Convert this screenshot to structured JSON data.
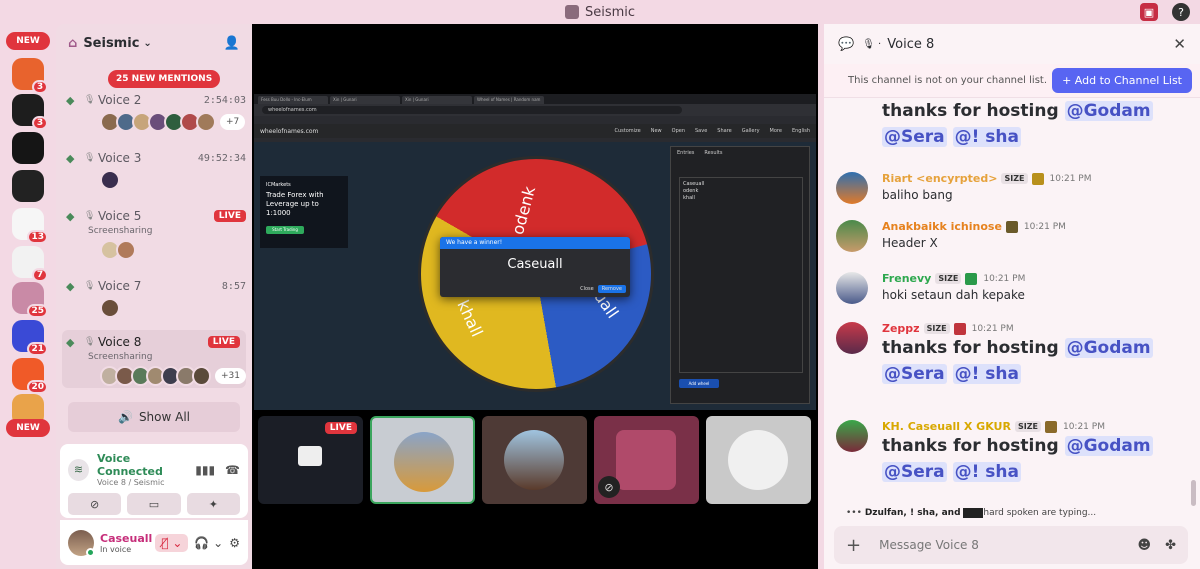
{
  "window": {
    "title": "Seismic"
  },
  "rail": {
    "new_top": "NEW",
    "new_bottom": "NEW",
    "servers": [
      {
        "icon": "orange-app-icon",
        "badge": "3",
        "color": "#e8632d"
      },
      {
        "icon": "dark-logo-icon",
        "badge": "3",
        "color": "#1d1d1d"
      },
      {
        "icon": "ring-logo-icon",
        "badge": "",
        "color": "#151515"
      },
      {
        "icon": "clock-logo-icon",
        "badge": "",
        "color": "#222"
      },
      {
        "icon": "p2-logo-icon",
        "badge": "13",
        "color": "#f6f6f6"
      },
      {
        "icon": "a-logo-icon",
        "badge": "7",
        "color": "#f2f2f2"
      },
      {
        "icon": "seismic-server-icon",
        "badge": "25",
        "color": "#c98aa6"
      },
      {
        "icon": "blue-logo-icon",
        "badge": "21",
        "color": "#3a4ad6"
      },
      {
        "icon": "bolt-logo-icon",
        "badge": "20",
        "color": "#f05a28"
      },
      {
        "icon": "monkey-logo-icon",
        "badge": "",
        "color": "#e9a34a"
      }
    ]
  },
  "sidebar": {
    "server_name": "Seismic",
    "mentions": "25 NEW MENTIONS",
    "channels": [
      {
        "name": "Voice 2",
        "timer": "2:54:03",
        "sub": "",
        "more": "+7",
        "live": ""
      },
      {
        "name": "Voice 3",
        "timer": "49:52:34",
        "sub": "",
        "more": "",
        "live": ""
      },
      {
        "name": "Voice 5",
        "timer": "",
        "sub": "Screensharing",
        "more": "",
        "live": "LIVE"
      },
      {
        "name": "Voice 7",
        "timer": "8:57",
        "sub": "",
        "more": "",
        "live": ""
      },
      {
        "name": "Voice 8",
        "timer": "",
        "sub": "Screensharing",
        "more": "+31",
        "live": "LIVE"
      }
    ],
    "show_all": "Show All"
  },
  "voice_panel": {
    "title": "Voice Connected",
    "subtitle": "Voice 8 / Seismic"
  },
  "user": {
    "name": "Caseuall",
    "status": "In voice"
  },
  "stream": {
    "site": "wheelofnames.com",
    "tabs": [
      "Fess Buu Dollo - Inc-Elum",
      "Xin | Gunari",
      "Xin | Gunari",
      "Wheel of Names | Random nam"
    ],
    "url": "wheelofnames.com",
    "menu": [
      "Customize",
      "New",
      "Open",
      "Save",
      "Share",
      "Gallery",
      "More",
      "English"
    ],
    "ad": {
      "brand": "ICMarkets",
      "headline": "Trade Forex with Leverage up to 1:1000",
      "cta": "Start Trading"
    },
    "panel_tabs": [
      "Entries",
      "Results"
    ],
    "entries": [
      "Caseuall",
      "odenk",
      "khall"
    ],
    "add_wheel": "Add wheel",
    "wheel_labels": [
      "odenk",
      "Caseuall",
      "khall"
    ],
    "winner": {
      "title": "We have a winner!",
      "name": "Caseuall",
      "close": "Close",
      "remove": "Remove"
    },
    "live_badge": "LIVE"
  },
  "chat": {
    "channel": "Voice 8",
    "notice": "This channel is not on your channel list.",
    "add_button": "Add to Channel List",
    "messages": [
      {
        "user": "",
        "tag": "",
        "time": "",
        "text": "",
        "big": [
          "thanks for hosting ",
          "@Godam",
          " ",
          "@Sera",
          " ",
          "@! sha"
        ],
        "color": "#2b2d31"
      },
      {
        "user": "Riart <encyrpted>",
        "tag": "SIZE",
        "time": "10:21 PM",
        "text": "baliho bang",
        "color": "#e6a23c"
      },
      {
        "user": "Anakbaikk ichinose",
        "tag": "",
        "time": "10:21 PM",
        "text": "Header X",
        "color": "#e6821e"
      },
      {
        "user": "Frenevy",
        "tag": "SIZE",
        "time": "10:21 PM",
        "text": "hoki setaun dah kepake",
        "color": "#2ea84f"
      },
      {
        "user": "Zeppz",
        "tag": "SIZE",
        "time": "10:21 PM",
        "text": "",
        "big": [
          "thanks for hosting ",
          "@Godam",
          " ",
          "@Sera",
          " ",
          "@! sha"
        ],
        "color": "#e0353d"
      },
      {
        "user": "KH. Caseuall X GKUR",
        "tag": "SIZE",
        "time": "10:21 PM",
        "text": "",
        "big": [
          "thanks for hosting ",
          "@Godam",
          " ",
          "@Sera",
          " ",
          "@! sha"
        ],
        "color": "#d8a800"
      }
    ],
    "typing": "Dzulfan, ! sha, and",
    "typing_tail": "hard spoken are typing...",
    "composer_placeholder": "Message  Voice 8"
  }
}
